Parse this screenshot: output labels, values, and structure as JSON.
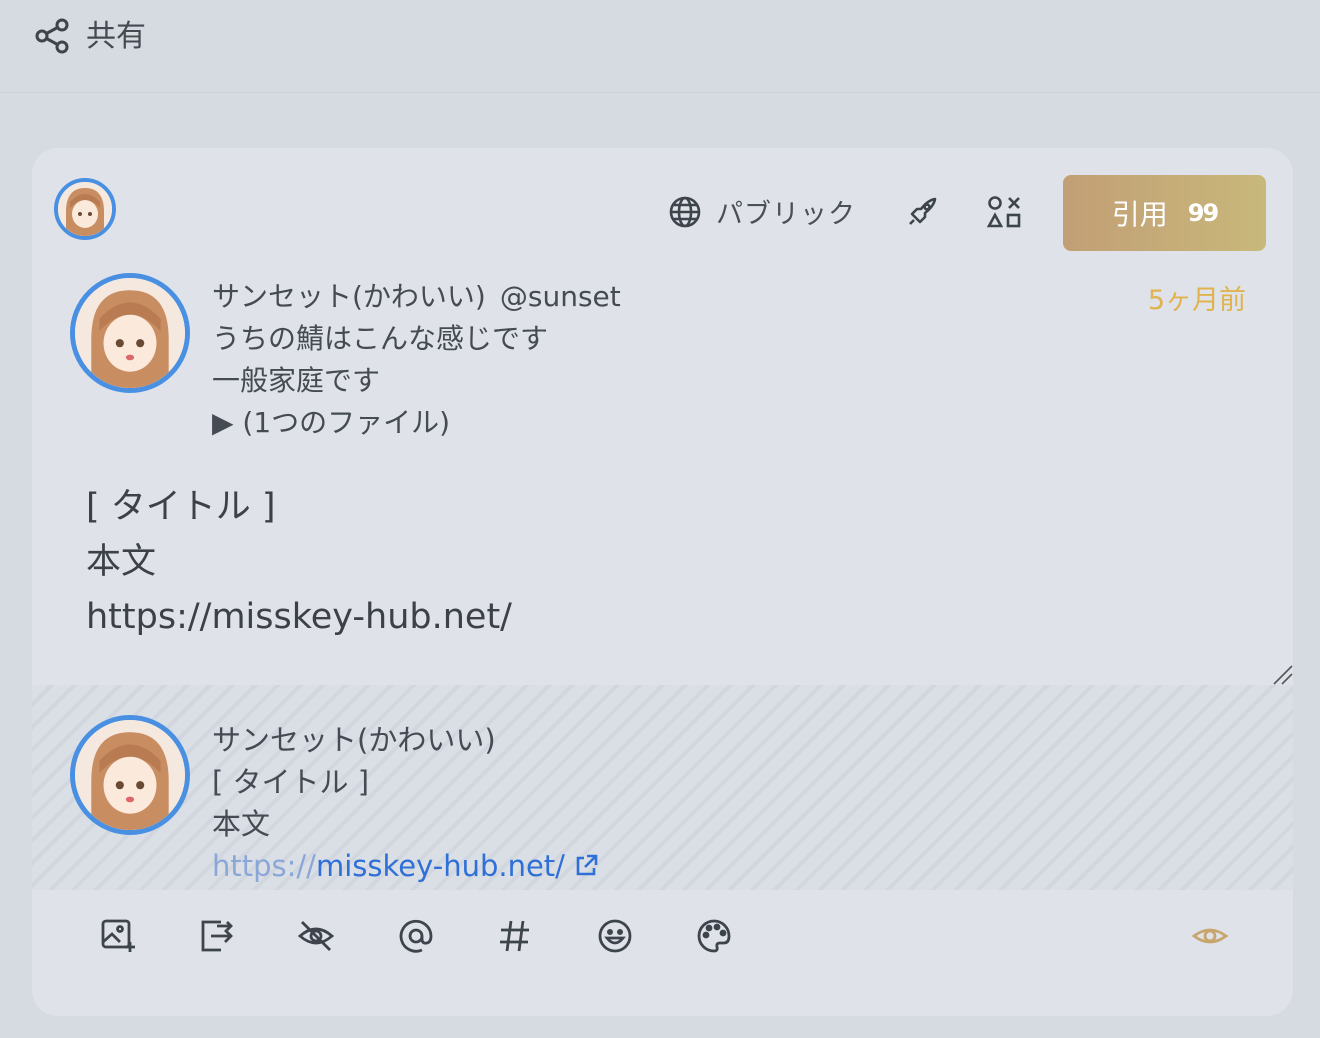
{
  "header": {
    "title": "共有"
  },
  "visibility": {
    "label": "パブリック"
  },
  "submit": {
    "label": "引用",
    "icon": "99"
  },
  "reply": {
    "user": "サンセット(かわいい)",
    "handle": "@sunset",
    "time": "5ヶ月前",
    "lines": [
      "うちの鯖はこんな感じです",
      "一般家庭です",
      "▶ (1つのファイル)"
    ]
  },
  "editor": {
    "lines": [
      "[ タイトル ]",
      "本文",
      "https://misskey-hub.net/"
    ]
  },
  "quote": {
    "user": "サンセット(かわいい)",
    "lines": [
      "[ タイトル ]",
      "本文"
    ],
    "link_proto": "https://",
    "link_rest": "misskey-hub.net/"
  },
  "colors": {
    "accent": "#4a90e2",
    "submit_start": "#c29f76",
    "submit_end": "#c8b87a",
    "time": "#e0b34f",
    "link": "#2f6fd8"
  },
  "footer_icons": [
    "image-add-icon",
    "file-share-icon",
    "eye-off-icon",
    "mention-icon",
    "hashtag-icon",
    "emoji-icon",
    "palette-icon"
  ]
}
